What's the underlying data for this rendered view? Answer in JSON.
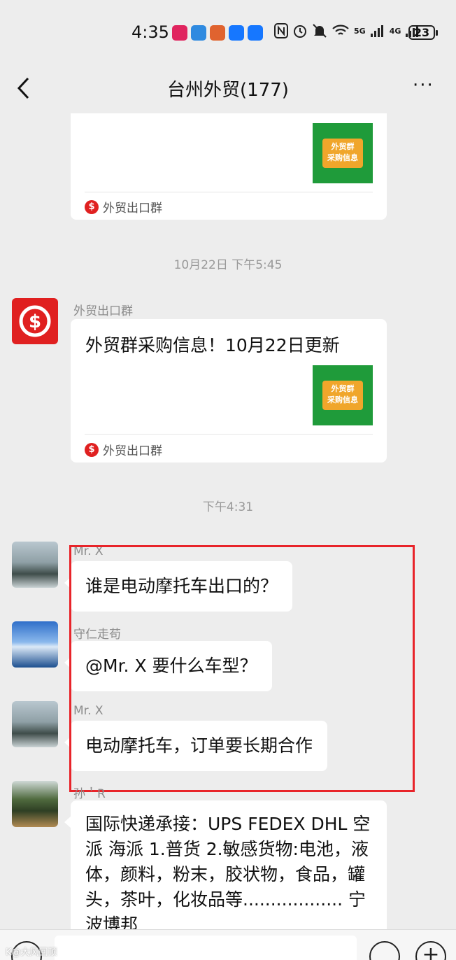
{
  "status_bar": {
    "time": "4:35",
    "network_5g": "5G",
    "network_4g": "4G",
    "battery": "23"
  },
  "nav": {
    "title": "台州外贸(177)",
    "more": "···"
  },
  "messages": {
    "card1": {
      "thumb_line1": "外贸群",
      "thumb_line2": "采购信息",
      "source": "外贸出口群"
    },
    "ts1": "10月22日 下午5:45",
    "card2": {
      "sender": "外贸出口群",
      "title": "外贸群采购信息！10月22日更新",
      "thumb_line1": "外贸群",
      "thumb_line2": "采购信息",
      "source": "外贸出口群"
    },
    "ts2": "下午4:31",
    "msg1": {
      "sender": "Mr. X",
      "text": "谁是电动摩托车出口的？"
    },
    "msg2": {
      "sender": "守仁走苟",
      "text": "@Mr. X  要什么车型？"
    },
    "msg3": {
      "sender": "Mr. X",
      "text": "电动摩托车，订单要长期合作"
    },
    "msg4": {
      "sender": "孙＇R",
      "text": "国际快递承接：UPS FEDEX DHL  空派  海派      1.普货          2.敏感货物:电池，液体，颜料，粉末，胶状物，食品，罐头，茶叶，化妆品等..................       宁波博邦"
    }
  },
  "watermark": "K@大风回顶",
  "colors": {
    "background": "#ededed",
    "bubble": "#ffffff",
    "highlight": "#e8242a",
    "thumb_green": "#1f9b3a",
    "thumb_orange": "#f0a62b",
    "source_red": "#e02020"
  },
  "icons": [
    "back-icon",
    "more-icon",
    "voice-icon",
    "emoji-icon",
    "plus-icon"
  ]
}
